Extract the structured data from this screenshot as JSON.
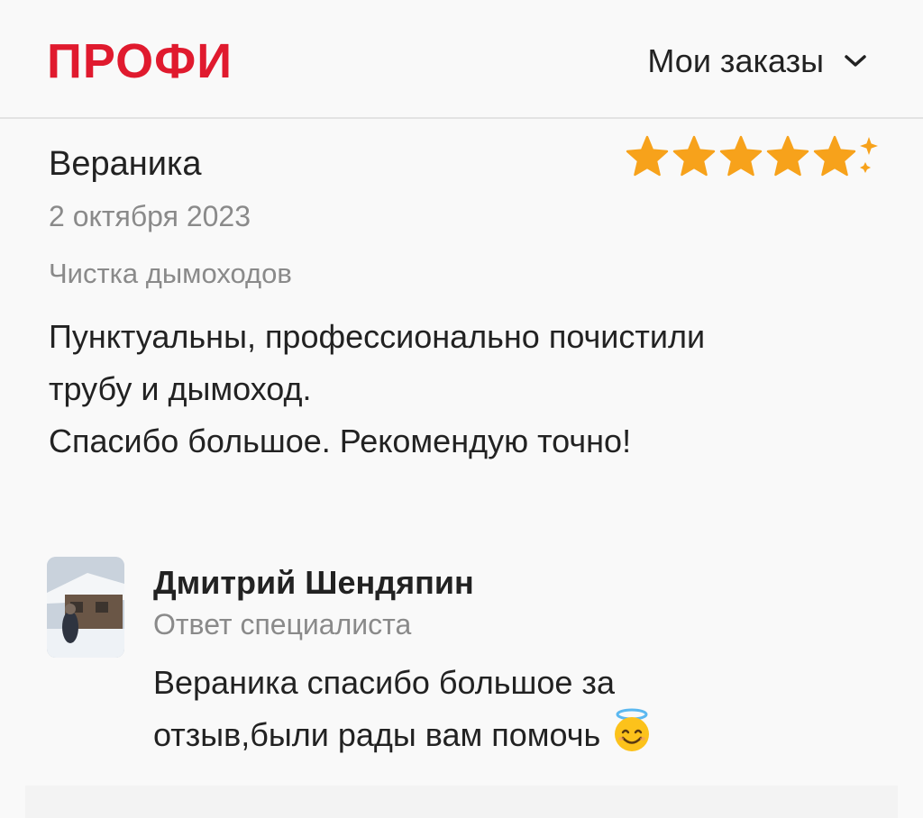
{
  "header": {
    "logo": "ПРОФИ",
    "menu_label": "Мои заказы",
    "menu_icon": "chevron-down-icon"
  },
  "colors": {
    "brand": "#e01a2e",
    "star": "#f7a21b",
    "muted": "#8a8a8a"
  },
  "review": {
    "author": "Вераника",
    "date": "2 октября 2023",
    "service": "Чистка дымоходов",
    "rating": 5,
    "rating_max": 5,
    "text_lines": [
      "Пунктуальны, профессионально почистили",
      "трубу и дымоход.",
      "Спасибо большое. Рекомендую точно!"
    ]
  },
  "reply": {
    "author": "Дмитрий Шендяпин",
    "subtitle": "Ответ специалиста",
    "text_lines": [
      "Вераника спасибо большое за",
      "отзыв,были рады вам помочь"
    ],
    "emoji": "smiling-face-with-halo-icon"
  }
}
